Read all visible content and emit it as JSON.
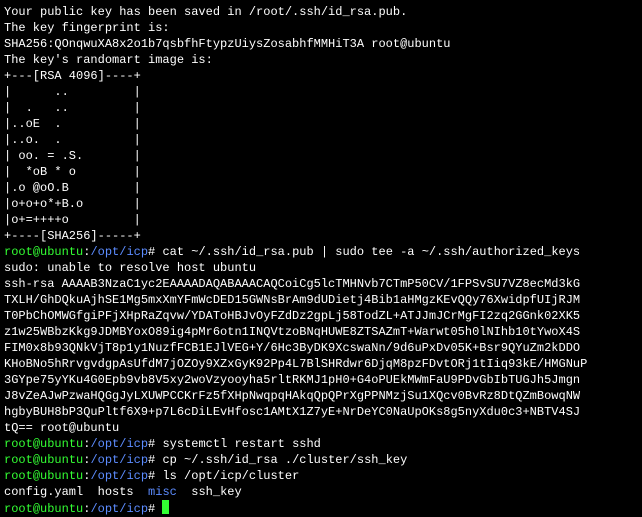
{
  "preamble": [
    "Your public key has been saved in /root/.ssh/id_rsa.pub.",
    "The key fingerprint is:",
    "SHA256:QOnqwuXA8x2o1b7qsbfhFtypzUiysZosabhfMMHiT3A root@ubuntu",
    "The key's randomart image is:",
    "+---[RSA 4096]----+",
    "|      ..         |",
    "|  .   ..         |",
    "|..oE  .          |",
    "|..o.  .          |",
    "| oo. = .S.       |",
    "|  *oB * o        |",
    "|.o @oO.B         |",
    "|o+o+o*+B.o       |",
    "|o+=++++o         |",
    "+----[SHA256]-----+"
  ],
  "prompt1": {
    "user": "root",
    "host": "ubuntu",
    "path": "/opt/icp",
    "cmd": "cat ~/.ssh/id_rsa.pub | sudo tee -a ~/.ssh/authorized_keys"
  },
  "sshpub": [
    "sudo: unable to resolve host ubuntu",
    "ssh-rsa AAAAB3NzaC1yc2EAAAADAQABAAACAQCoiCg5lcTMHNvb7CTmP50CV/1FPSvSU7VZ8ecMd3kG",
    "TXLH/GhDQkuAjhSE1Mg5mxXmYFmWcDED15GWNsBrAm9dUDietj4Bib1aHMgzKEvQQy76XwidpfUIjRJM",
    "T0PbChOMWGfgiPFjXHpRaZqvw/YDAToHBJvOyFZdDz2gpLj58TodZL+ATJJmJCrMgFI2zq2GGnk02XK5",
    "z1w25WBbzKkg9JDMBYoxO89ig4pMr6otn1INQVtzoBNqHUWE8ZTSAZmT+Warwt05h0lNIhb10tYwoX4S",
    "FIM0x8b93QNkVjT8p1y1NuzfFCB1EJlVEG+Y/6Hc3ByDK9XcswaNn/9d6uPxDv05K+Bsr9QYuZm2kDDO",
    "KHoBNo5hRrvgvdgpAsUfdM7jOZOy9XZxGyK92Pp4L7BlSHRdwr6DjqM8pzFDvtORj1tIiq93kE/HMGNuP",
    "3GYpe75yYKu4G0Epb9vb8V5xy2woVzyooyha5rltRKMJ1pH0+G4oPUEkMWmFaU9PDvGbIbTUGJh5Jmgn",
    "J8vZeAJwPzwaHQGgJyLXUWPCCKrFz5fXHpNwqpqHAkqQpQPrXgPPNMzjSu1XQcv0BvRz8DtQZmBowqNW",
    "hgbyBUH8bP3QuPltf6X9+p7L6cDiLEvHfosc1AMtX1Z7yE+NrDeYC0NaUpOKs8g5nyXdu0c3+NBTV4SJ",
    "tQ== root@ubuntu"
  ],
  "prompt2": {
    "user": "root",
    "host": "ubuntu",
    "path": "/opt/icp",
    "cmd": "systemctl restart sshd"
  },
  "prompt3": {
    "user": "root",
    "host": "ubuntu",
    "path": "/opt/icp",
    "cmd": "cp ~/.ssh/id_rsa ./cluster/ssh_key"
  },
  "prompt4": {
    "user": "root",
    "host": "ubuntu",
    "path": "/opt/icp",
    "cmd": "ls /opt/icp/cluster"
  },
  "ls": {
    "f1": "config.yaml",
    "f2": "hosts",
    "dir": "misc",
    "f3": "ssh_key"
  },
  "prompt5": {
    "user": "root",
    "host": "ubuntu",
    "path": "/opt/icp",
    "cmd": ""
  }
}
